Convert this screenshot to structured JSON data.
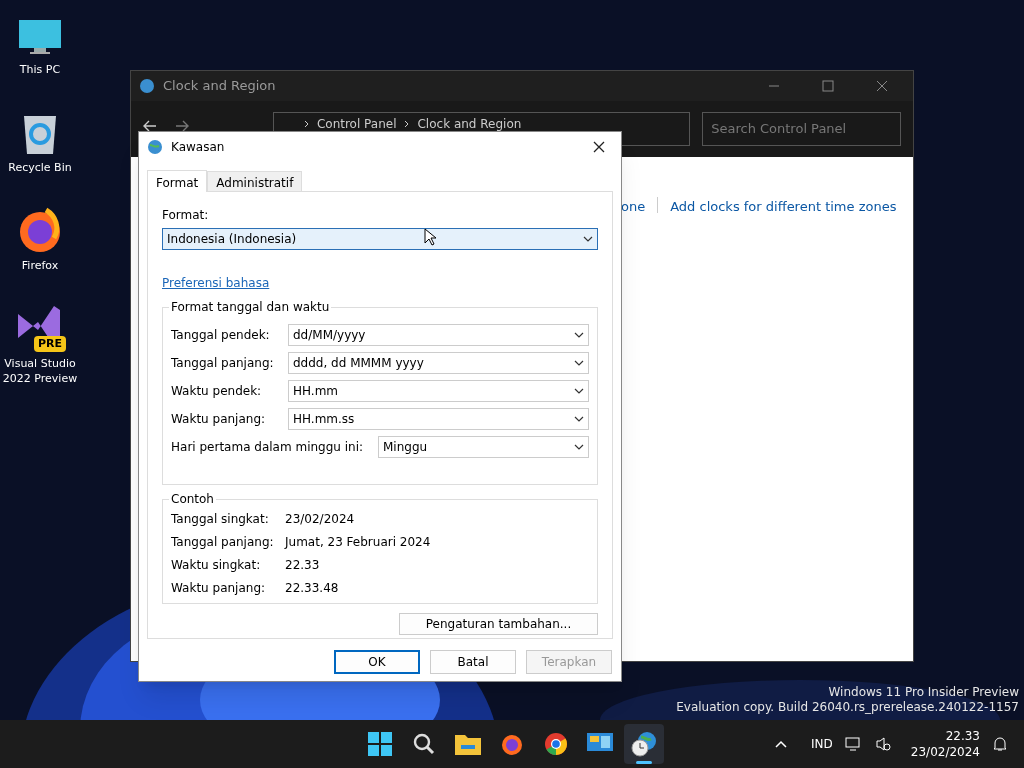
{
  "desktop_icons": [
    {
      "label": "This PC",
      "kind": "pc"
    },
    {
      "label": "Recycle Bin",
      "kind": "bin"
    },
    {
      "label": "Firefox",
      "kind": "firefox"
    },
    {
      "label": "Visual Studio 2022 Preview",
      "kind": "vs",
      "badge": "PRE"
    }
  ],
  "background_window": {
    "title": "Clock and Region",
    "breadcrumb": [
      "Control Panel",
      "Clock and Region"
    ],
    "search": {
      "placeholder": "Search Control Panel"
    },
    "links": [
      "one",
      "Add clocks for different time zones"
    ]
  },
  "dialog": {
    "title": "Kawasan",
    "tabs": [
      {
        "label": "Format",
        "selected": true
      },
      {
        "label": "Administratif",
        "selected": false
      }
    ],
    "format_label": "Format:",
    "format_value": "Indonesia (Indonesia)",
    "language_link": "Preferensi bahasa",
    "datetime_group": {
      "title": "Format tanggal dan waktu",
      "fields": [
        {
          "label": "Tanggal pendek:",
          "value": "dd/MM/yyyy"
        },
        {
          "label": "Tanggal panjang:",
          "value": "dddd, dd MMMM yyyy"
        },
        {
          "label": "Waktu pendek:",
          "value": "HH.mm"
        },
        {
          "label": "Waktu panjang:",
          "value": "HH.mm.ss"
        }
      ],
      "first_day": {
        "label": "Hari pertama dalam minggu ini:",
        "value": "Minggu"
      }
    },
    "example_group": {
      "title": "Contoh",
      "rows": [
        {
          "label": "Tanggal singkat:",
          "value": "23/02/2024"
        },
        {
          "label": "Tanggal panjang:",
          "value": "Jumat, 23 Februari 2024"
        },
        {
          "label": "Waktu singkat:",
          "value": "22.33"
        },
        {
          "label": "Waktu panjang:",
          "value": "22.33.48"
        }
      ]
    },
    "more_button": "Pengaturan tambahan...",
    "buttons": [
      {
        "label": "OK",
        "disabled": false,
        "default": true
      },
      {
        "label": "Batal",
        "disabled": false,
        "default": false
      },
      {
        "label": "Terapkan",
        "disabled": true,
        "default": false
      }
    ]
  },
  "watermark": [
    "Windows 11 Pro Insider Preview",
    "Evaluation copy. Build 26040.rs_prerelease.240122-1157"
  ],
  "taskbar": {
    "apps": [
      {
        "kind": "start",
        "active": false
      },
      {
        "kind": "search",
        "active": false
      },
      {
        "kind": "explorer",
        "active": false
      },
      {
        "kind": "firefox",
        "active": false
      },
      {
        "kind": "chrome",
        "active": false
      },
      {
        "kind": "control",
        "active": false
      },
      {
        "kind": "region",
        "active": true
      }
    ],
    "language": "IND",
    "time": "22.33",
    "date": "23/02/2024"
  }
}
